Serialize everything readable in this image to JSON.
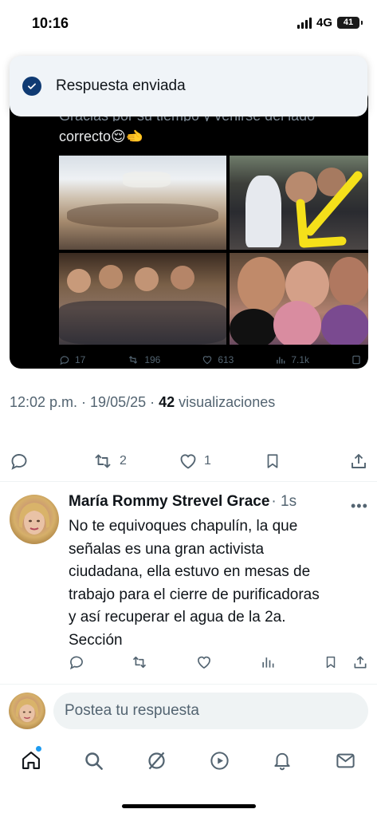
{
  "status_bar": {
    "time": "10:16",
    "network": "4G",
    "battery": "41"
  },
  "toast": {
    "text": "Respuesta enviada",
    "icon": "check-circle-icon"
  },
  "embedded_post": {
    "caption_cut": "Gracias por su tiempo y venirse del lado",
    "caption": "correcto😌🫲",
    "metrics": {
      "replies": "17",
      "reposts": "196",
      "likes": "613",
      "views": "7.1k"
    }
  },
  "post_meta": {
    "time_date": "12:02 p.m. · 19/05/25 · ",
    "views_count": "42",
    "views_label": " visualizaciones"
  },
  "post_actions": {
    "reposts": "2",
    "likes": "1"
  },
  "reply": {
    "name": "María Rommy Strevel Grace",
    "time": "· 1s",
    "more": "•••",
    "text": "No te equivoques chapulín, la que\nseñalas es una gran activista\nciudadana, ella estuvo en mesas de\ntrabajo para el cierre de purificadoras\ny así recuperar el agua de la 2a.\nSección"
  },
  "compose": {
    "placeholder": "Postea tu respuesta"
  },
  "nav": [
    "home-icon",
    "search-icon",
    "grok-icon",
    "video-icon",
    "notifications-icon",
    "messages-icon"
  ],
  "colors": {
    "accent": "#1d9bf0",
    "toast_check": "#0f3a73",
    "secondary_text": "#536471",
    "arrow": "#f5e01a"
  }
}
